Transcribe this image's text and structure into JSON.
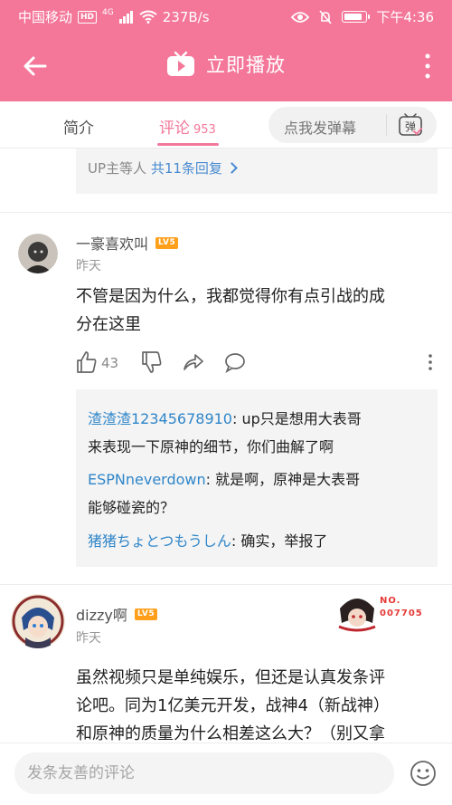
{
  "status_bar": {
    "carrier": "中国移动",
    "hd": "HD",
    "signal": "4G",
    "speed": "237B/s",
    "time": "下午4:36"
  },
  "header": {
    "title": "立即播放"
  },
  "tabs": {
    "intro": "简介",
    "comments": "评论",
    "comment_count": "953",
    "danmaku_placeholder": "点我发弹幕",
    "danmaku_icon_char": "弹"
  },
  "up_reply": {
    "prefix": "UP主等人",
    "count_text": "共11条回复"
  },
  "comments": [
    {
      "username": "一豪喜欢叫",
      "level": "LV5",
      "time": "昨天",
      "lines": [
        "不管是因为什么，我都觉得你有点引战的成",
        "分在这里"
      ],
      "likes": "43",
      "replies": [
        {
          "name": "渣渣渣12345678910",
          "line1": ": up只是想用大表哥",
          "line2": "来表现一下原神的细节，你们曲解了啊"
        },
        {
          "name": "ESPNneverdown",
          "line1": ": 就是啊，原神是大表哥",
          "line2": "能够碰瓷的？"
        },
        {
          "name": "猪猪ちょとつもうしん",
          "line1": ": 确实，举报了",
          "line2": ""
        }
      ]
    },
    {
      "username": "dizzy啊",
      "level": "LV5",
      "time": "昨天",
      "badge_no": "NO.",
      "badge_num": "007705",
      "lines": [
        "虽然视频只是单纯娱乐，但还是认真发条评",
        "论吧。同为1亿美元开发，战神4（新战神）",
        "和原神的质量为什么相差这么大？（别又拿"
      ]
    }
  ],
  "bottom": {
    "input_placeholder": "发条友善的评论"
  },
  "colors": {
    "brand_pink": "#f4779a",
    "link_blue": "#2f86c9",
    "level_orange": "#ff9f1a"
  }
}
